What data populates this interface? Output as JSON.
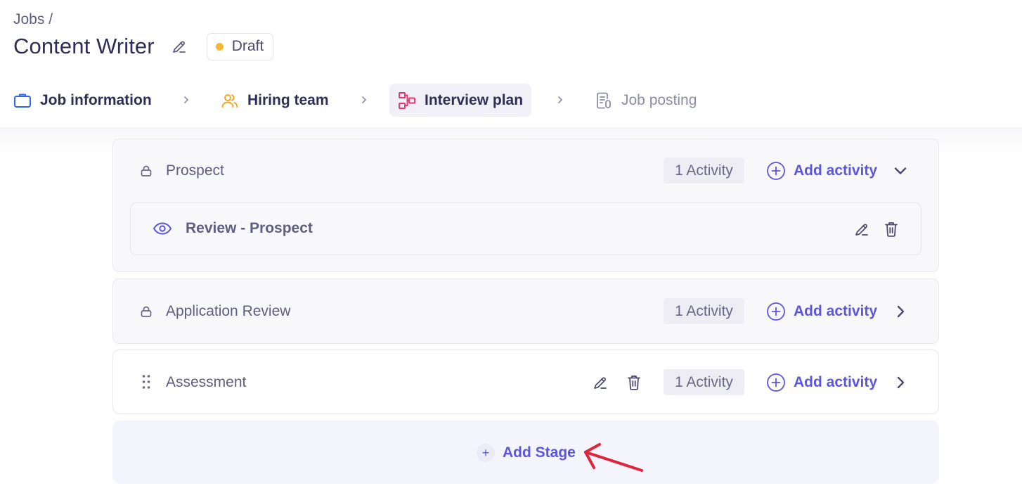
{
  "breadcrumb": "Jobs /",
  "job": {
    "title": "Content Writer",
    "status": "Draft"
  },
  "steps": [
    {
      "label": "Job information",
      "icon": "briefcase-icon"
    },
    {
      "label": "Hiring team",
      "icon": "users-icon"
    },
    {
      "label": "Interview plan",
      "icon": "workflow-icon"
    },
    {
      "label": "Job posting",
      "icon": "document-icon"
    }
  ],
  "stages": [
    {
      "name": "Prospect",
      "activity_count": "1 Activity",
      "add_label": "Add activity",
      "locked": true,
      "expanded": true,
      "activities": [
        {
          "name": "Review - Prospect",
          "icon": "eye-icon"
        }
      ]
    },
    {
      "name": "Application Review",
      "activity_count": "1 Activity",
      "add_label": "Add activity",
      "locked": true,
      "expanded": false
    },
    {
      "name": "Assessment",
      "activity_count": "1 Activity",
      "add_label": "Add activity",
      "locked": false,
      "expanded": false
    }
  ],
  "add_stage_label": "Add Stage",
  "colors": {
    "accent": "#5b55e0",
    "title": "#2f2e55",
    "draft_dot": "#f5b830",
    "annotation": "#e0243a",
    "interview_icon": "#e8336d",
    "hiring_icon": "#f5a623",
    "job_info_icon": "#3366e6"
  }
}
